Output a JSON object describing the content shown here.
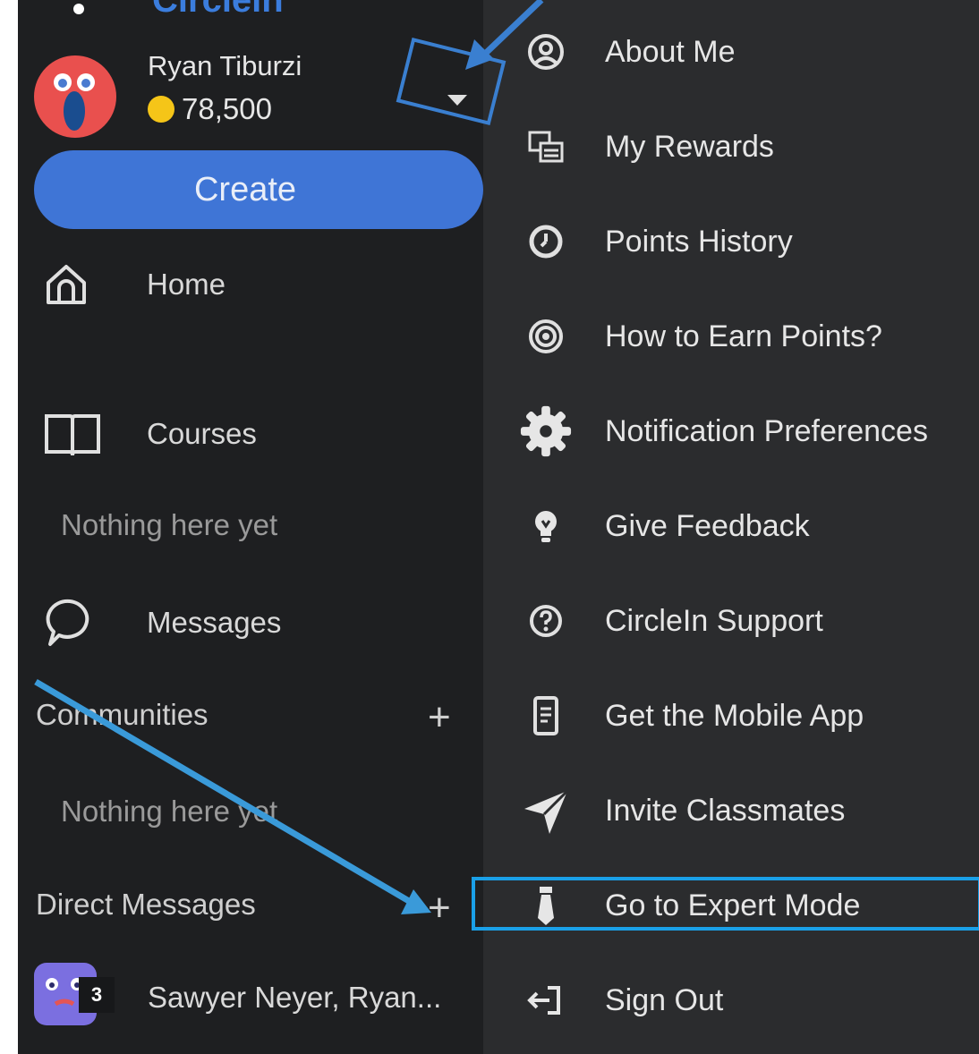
{
  "app": {
    "logo_text": "Circleln"
  },
  "user": {
    "name": "Ryan Tiburzi",
    "points": "78,500"
  },
  "sidebar": {
    "create_label": "Create",
    "nav": [
      {
        "label": "Home",
        "icon": "home-icon"
      },
      {
        "label": "Courses",
        "icon": "book-icon"
      },
      {
        "label": "Messages",
        "icon": "chat-bubble-icon"
      }
    ],
    "courses_empty": "Nothing here yet",
    "communities": {
      "title": "Communities",
      "empty": "Nothing here yet",
      "add": "+"
    },
    "direct_messages": {
      "title": "Direct Messages",
      "add": "+",
      "items": [
        {
          "name": "Sawyer Neyer, Ryan...",
          "badge": "3"
        }
      ]
    }
  },
  "menu": {
    "items": [
      {
        "label": "About Me",
        "icon": "user-circle-icon"
      },
      {
        "label": "My Rewards",
        "icon": "rewards-icon"
      },
      {
        "label": "Points History",
        "icon": "clock-icon"
      },
      {
        "label": "How to Earn Points?",
        "icon": "target-icon"
      },
      {
        "label": "Notification Preferences",
        "icon": "gear-icon"
      },
      {
        "label": "Give Feedback",
        "icon": "lightbulb-icon"
      },
      {
        "label": "CircleIn Support",
        "icon": "help-icon"
      },
      {
        "label": "Get the Mobile App",
        "icon": "mobile-icon"
      },
      {
        "label": "Invite Classmates",
        "icon": "send-icon"
      },
      {
        "label": "Go to Expert Mode",
        "icon": "tie-icon"
      },
      {
        "label": "Sign Out",
        "icon": "sign-out-icon"
      }
    ]
  },
  "colors": {
    "sidebar_bg": "#1e1f21",
    "menu_bg": "#2b2c2e",
    "accent": "#3f75d6",
    "annotation": "#3a9ad9"
  }
}
